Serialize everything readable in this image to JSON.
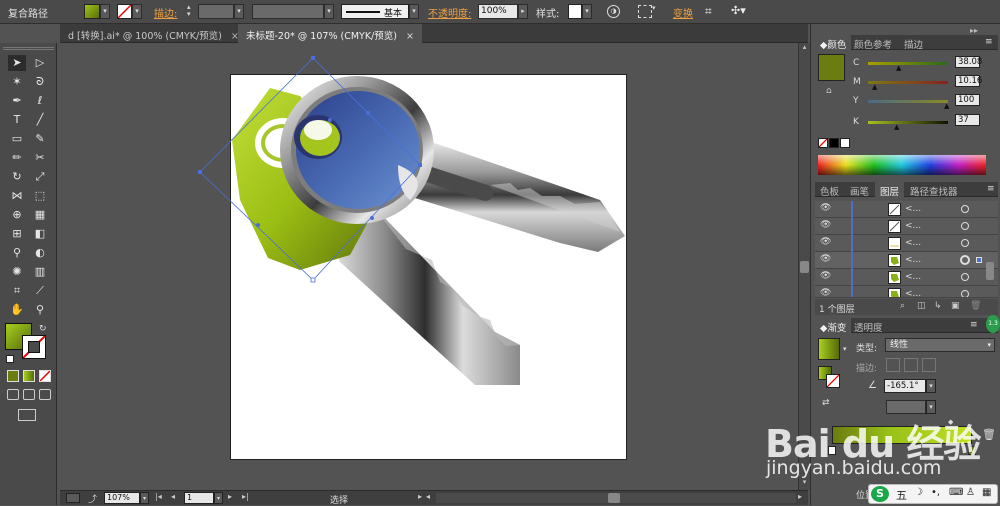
{
  "control_bar": {
    "object_type": "复合路径",
    "stroke_label": "描边:",
    "stroke_profile": "基本",
    "opacity_label": "不透明度:",
    "opacity_value": "100%",
    "style_label": "样式:",
    "transform_label": "变换"
  },
  "tabs": [
    {
      "label": "d [转换].ai* @ 100% (CMYK/预览)",
      "active": false
    },
    {
      "label": "未标题-20* @ 107% (CMYK/预览)",
      "active": true
    }
  ],
  "status": {
    "zoom": "107%",
    "page": "1",
    "tool": "选择"
  },
  "color_panel": {
    "tabs": [
      "颜色",
      "颜色参考",
      "描边"
    ],
    "channels": [
      {
        "name": "C",
        "value": "38.08"
      },
      {
        "name": "M",
        "value": "10.16"
      },
      {
        "name": "Y",
        "value": "100"
      },
      {
        "name": "K",
        "value": "37"
      }
    ],
    "fill_color": "#6b7c10"
  },
  "layers_panel": {
    "tabs": [
      "色板",
      "画笔",
      "图层",
      "路径查找器"
    ],
    "rows": [
      "<...",
      "<...",
      "<...",
      "<...",
      "<...",
      "<..."
    ],
    "footer": "1 个图层"
  },
  "gradient_panel": {
    "tabs": [
      "渐变",
      "透明度"
    ],
    "type_label": "类型:",
    "type_value": "线性",
    "stroke_label": "描边:",
    "angle_value": "-165.1°",
    "position_label": "位置"
  },
  "watermark": {
    "brand": "Bai du 经验",
    "url": "jingyan.baidu.com"
  },
  "ime": "五"
}
